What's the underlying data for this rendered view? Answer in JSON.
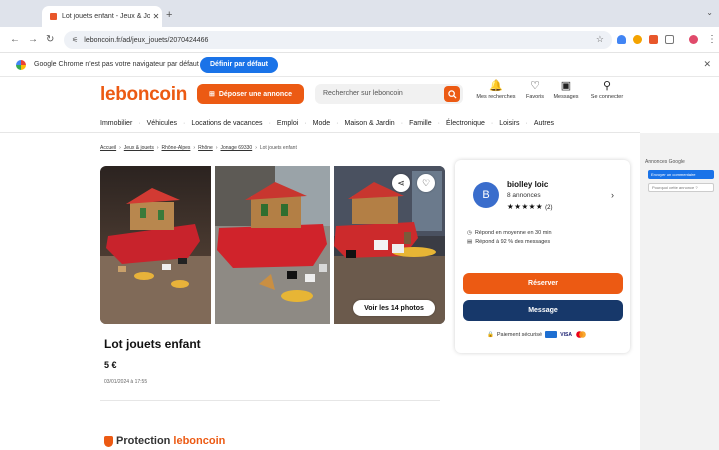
{
  "browser": {
    "tab_title": "Lot jouets enfant - Jeux & Jo",
    "tab_close": "✕",
    "new_tab": "+",
    "url": "leboncoin.fr/ad/jeux_jouets/2070424466",
    "infobar_message": "Google Chrome n'est pas votre navigateur par défaut",
    "infobar_button": "Définir par défaut",
    "infobar_close": "✕"
  },
  "header": {
    "logo": "leboncoin",
    "post_ad": "Déposer une annonce",
    "post_ad_icon": "⊞",
    "search_placeholder": "Rechercher sur leboncoin",
    "icons": [
      {
        "glyph": "🔔",
        "label": "Mes recherches"
      },
      {
        "glyph": "♡",
        "label": "Favoris"
      },
      {
        "glyph": "▣",
        "label": "Messages"
      },
      {
        "glyph": "⚲",
        "label": "Se connecter"
      }
    ],
    "categories": [
      "Immobilier",
      "Véhicules",
      "Locations de vacances",
      "Emploi",
      "Mode",
      "Maison & Jardin",
      "Famille",
      "Électronique",
      "Loisirs",
      "Autres"
    ]
  },
  "breadcrumbs": [
    "Accueil",
    "Jeux & jouets",
    "Rhône-Alpes",
    "Rhône",
    "Jonage 69330",
    "Lot jouets enfant"
  ],
  "listing": {
    "view_photos": "Voir les 14 photos",
    "title": "Lot jouets enfant",
    "price": "5 €",
    "date": "03/01/2024 à 17:55",
    "protection_a": "Protection",
    "protection_b": "leboncoin"
  },
  "seller": {
    "initial": "B",
    "name": "biolley loic",
    "ads": "8 annonces",
    "stars": "★★★★★",
    "reviews": "(2)",
    "response_time": "Répond en moyenne en 30 min",
    "response_rate": "Répond à 92 % des messages",
    "reserve": "Réserver",
    "message": "Message",
    "payment": "Paiement sécurisé"
  },
  "ads": {
    "label": "Annonces Google",
    "report": "Envoyer un commentaire",
    "why": "Pourquoi cette annonce ?"
  },
  "colors": {
    "brand_orange": "#ec5a13",
    "message_blue": "#17386a",
    "chrome_blue": "#1a73e8"
  }
}
